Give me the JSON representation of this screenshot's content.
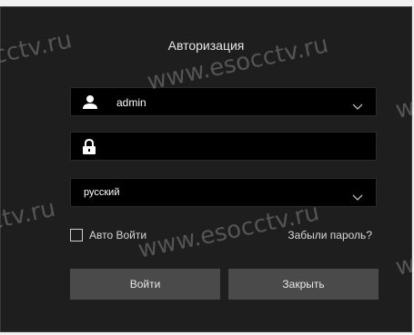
{
  "dialog": {
    "title": "Авторизация"
  },
  "username": {
    "value": "admin"
  },
  "password": {
    "placeholder": ""
  },
  "language": {
    "selected": "русский"
  },
  "auto_login": {
    "label": "Авто Войти",
    "checked": false
  },
  "forgot_password": {
    "label": "Забыли пароль?"
  },
  "buttons": {
    "login_label": "Войти",
    "close_label": "Закрыть"
  },
  "watermark": {
    "full": "www.esocctv.ru",
    "fragment_left": "cctv.ru",
    "fragment_right_a": "ctv.ru",
    "fragment_right_b": "w",
    "fragment_mid": "www.esocctv.ru"
  },
  "icons": {
    "user": "user-icon",
    "lock": "lock-icon",
    "chevron": "chevron-down-icon"
  },
  "colors": {
    "dialog_bg": "#1e1e1e",
    "field_bg": "#000000",
    "button_bg": "#4a4a4a",
    "text": "#e6e6e6"
  }
}
